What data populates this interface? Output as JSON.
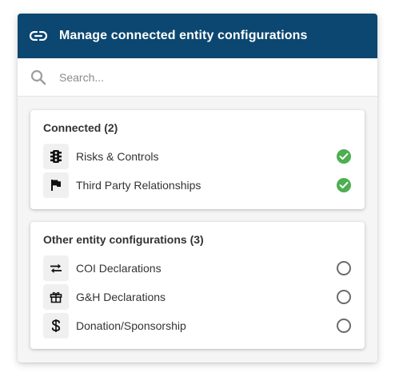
{
  "header": {
    "title": "Manage connected entity configurations",
    "icon": "link-icon",
    "background": "#0b4770"
  },
  "search": {
    "placeholder": "Search...",
    "value": ""
  },
  "connected": {
    "title": "Connected (2)",
    "items": [
      {
        "label": "Risks & Controls",
        "icon": "traffic-light-icon",
        "status": "checked"
      },
      {
        "label": "Third Party Relationships",
        "icon": "flag-icon",
        "status": "checked"
      }
    ]
  },
  "other": {
    "title": "Other entity configurations (3)",
    "items": [
      {
        "label": "COI Declarations",
        "icon": "swap-arrows-icon",
        "status": "unchecked"
      },
      {
        "label": "G&H Declarations",
        "icon": "gift-icon",
        "status": "unchecked"
      },
      {
        "label": "Donation/Sponsorship",
        "icon": "dollar-icon",
        "status": "unchecked"
      }
    ]
  },
  "colors": {
    "check": "#4caf50",
    "radio_border": "#6b6b6b"
  }
}
